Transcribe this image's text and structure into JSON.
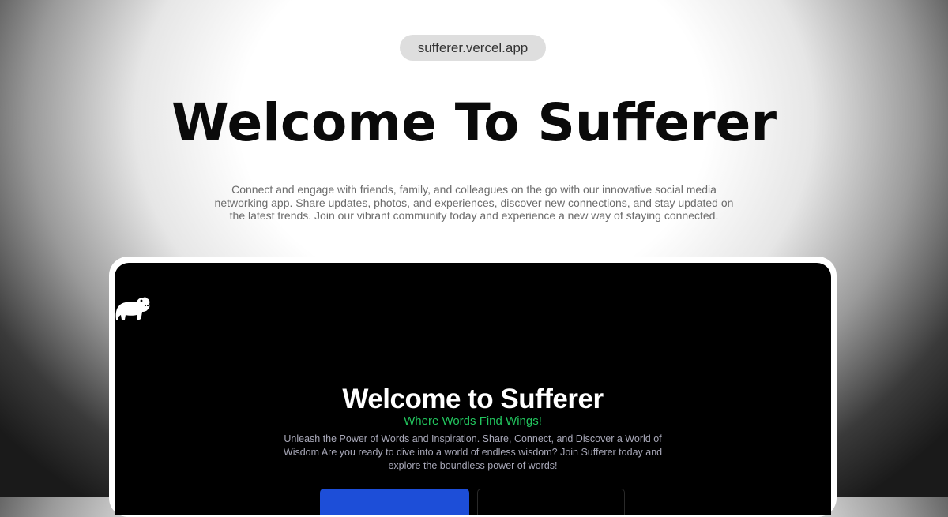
{
  "page": {
    "url": "sufferer.vercel.app",
    "title": "Welcome To Sufferer",
    "description": "Connect and engage with friends, family, and colleagues on the go with our innovative social media networking app. Share updates, photos, and experiences, discover new connections, and stay updated on the latest trends. Join our vibrant community today and experience a new way of staying connected."
  },
  "preview": {
    "logo_icon": "hippo-icon",
    "title": "Welcome to Sufferer",
    "tagline": "Where Words Find Wings!",
    "description": "Unleash the Power of Words and Inspiration. Share, Connect, and Discover a World of Wisdom Are you ready to dive into a world of endless wisdom? Join Sufferer today and explore the boundless power of words!",
    "accent_color": "#22c55e",
    "primary_button_color": "#1d4ed8"
  }
}
